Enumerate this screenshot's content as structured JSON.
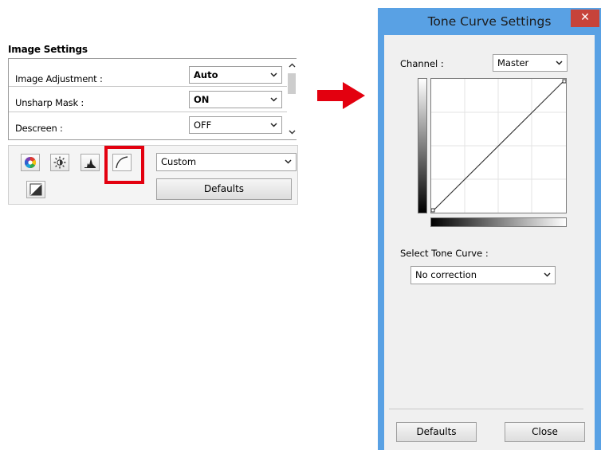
{
  "image_settings": {
    "title": "Image Settings",
    "rows": [
      {
        "label": "Image Adjustment :",
        "value": "Auto"
      },
      {
        "label": "Unsharp Mask :",
        "value": "ON"
      },
      {
        "label": "Descreen :",
        "value": "OFF"
      }
    ],
    "preset_select": "Custom",
    "defaults_label": "Defaults",
    "tool_icons": [
      "color-balance-icon",
      "brightness-contrast-icon",
      "histogram-icon",
      "tone-curve-icon",
      "final-review-icon"
    ]
  },
  "tone_curve_window": {
    "title": "Tone Curve Settings",
    "close_glyph": "✕",
    "channel_label": "Channel :",
    "channel_value": "Master",
    "select_curve_label": "Select Tone Curve :",
    "curve_value": "No correction",
    "defaults_label": "Defaults",
    "close_label": "Close"
  },
  "colors": {
    "highlight": "#e3000f",
    "arrow": "#e3000f",
    "window_frame": "#59a1e4",
    "close_button": "#c7433a"
  }
}
